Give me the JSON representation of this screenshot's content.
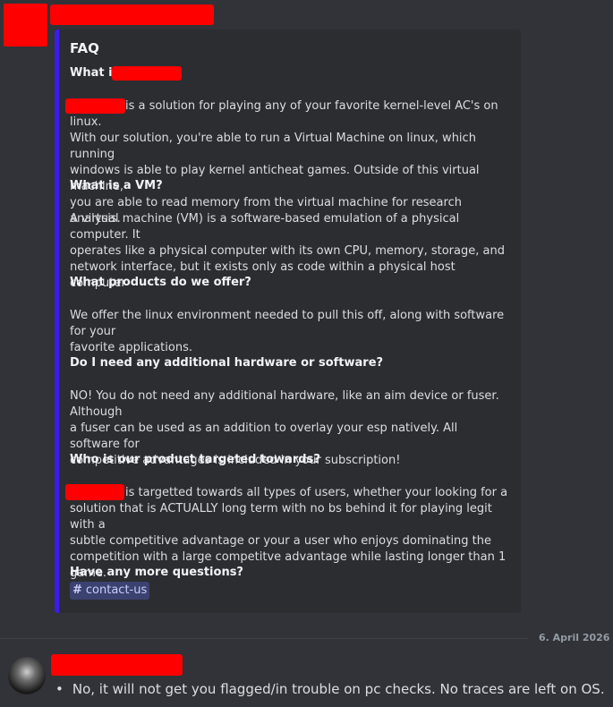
{
  "embed": {
    "title": "FAQ",
    "q1": "What is",
    "a1_lines": [
      "is a solution for playing any of your favorite kernel-level AC's on linux.",
      "With our solution, you're able to run a Virtual Machine on linux, which running",
      "windows is able to play kernel anticheat games. Outside of this virtual machine,",
      "you are able to read memory from the virtual machine for research analysis."
    ],
    "q2": "What is a VM?",
    "a2_lines": [
      "A virtual machine (VM) is a software-based emulation of a physical computer. It",
      "operates like a physical computer with its own CPU, memory, storage, and",
      "network interface, but it exists only as code within a physical host computer"
    ],
    "q3": "What products do we offer?",
    "a3_lines": [
      "We offer the linux environment needed to pull this off, along with software for your",
      "favorite applications."
    ],
    "q4": "Do I need any additional hardware or software?",
    "a4_lines": [
      "NO! You do not need any additional hardware, like an aim device or fuser. Although",
      "a fuser can be used as an addition to overlay your esp natively. All software for",
      "competitive advantages is included in your subscription!"
    ],
    "q5": "Who is our product targeted towards?",
    "a5_lines": [
      "is targetted towards all types of users, whether your looking for a",
      "solution that is ACTUALLY long term with no bs behind it for playing legit with a",
      "subtle competitive advantage or your a user who enjoys dominating the",
      "competition with a large competitve advantage while lasting longer than 1 game."
    ],
    "q6": "Have any more questions?",
    "channel": "contact-us"
  },
  "divider_date": "6. April 2026",
  "reply": {
    "text": "No, it will not get you flagged/in trouble on pc checks. No traces are left on OS."
  },
  "colors": {
    "background": "#313338",
    "embed_bg": "#2b2d31",
    "embed_accent": "#3b1ce8",
    "redaction": "#ff0000",
    "mention_bg": "#3c4270"
  }
}
